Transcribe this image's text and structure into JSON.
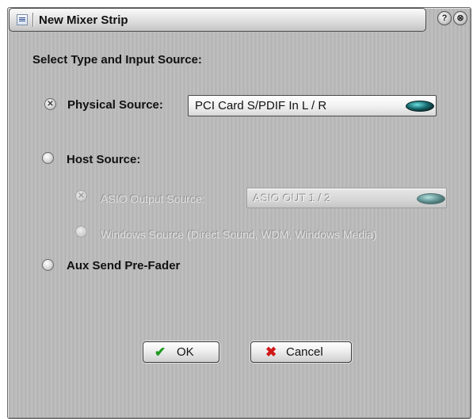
{
  "window": {
    "title": "New Mixer Strip",
    "help_icon": "?",
    "close_icon": "⊗"
  },
  "section_label": "Select Type and Input Source:",
  "options": {
    "physical": {
      "label": "Physical Source:",
      "selected": true,
      "dropdown_value": "PCI Card S/PDIF In L / R"
    },
    "host": {
      "label": "Host Source:",
      "selected": false
    },
    "asio": {
      "label": "ASIO Output Source:",
      "selected": true,
      "enabled": false,
      "dropdown_value": "ASIO OUT 1 / 2"
    },
    "windows": {
      "label": "Windows Source (Direct Sound, WDM, Windows Media)",
      "selected": false,
      "enabled": false
    },
    "aux": {
      "label": "Aux Send Pre-Fader",
      "selected": false
    }
  },
  "buttons": {
    "ok": {
      "label": "OK",
      "icon": "✔",
      "icon_color": "#1e9a1e"
    },
    "cancel": {
      "label": "Cancel",
      "icon": "✖",
      "icon_color": "#d01818"
    }
  },
  "radio_mark": "✕"
}
